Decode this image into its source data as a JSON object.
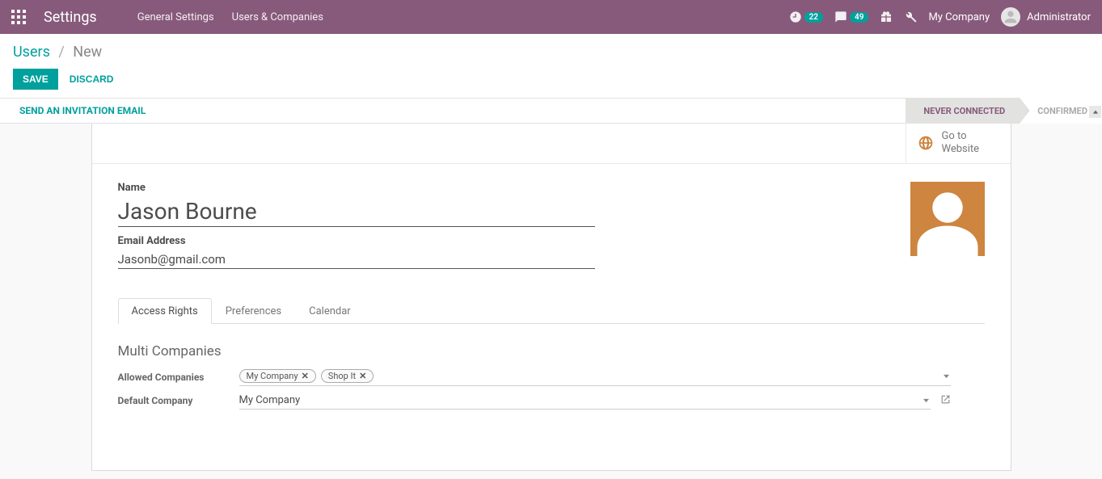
{
  "navbar": {
    "brand": "Settings",
    "menu": {
      "general": "General Settings",
      "users": "Users & Companies"
    },
    "activity_count": "22",
    "discuss_count": "49",
    "company": "My Company",
    "username": "Administrator"
  },
  "breadcrumb": {
    "parent": "Users",
    "current": "New"
  },
  "actions": {
    "save": "SAVE",
    "discard": "DISCARD"
  },
  "statusbar": {
    "invite": "SEND AN INVITATION EMAIL",
    "never_connected": "NEVER CONNECTED",
    "confirmed": "CONFIRMED"
  },
  "button_box": {
    "go_to_website_line1": "Go to",
    "go_to_website_line2": "Website"
  },
  "form": {
    "name_label": "Name",
    "name_value": "Jason Bourne",
    "email_label": "Email Address",
    "email_value": "Jasonb@gmail.com"
  },
  "tabs": {
    "access_rights": "Access Rights",
    "preferences": "Preferences",
    "calendar": "Calendar"
  },
  "section": {
    "multi_companies": "Multi Companies"
  },
  "multi": {
    "allowed_label": "Allowed Companies",
    "tag1": "My Company",
    "tag2": "Shop It",
    "default_label": "Default Company",
    "default_value": "My Company"
  }
}
